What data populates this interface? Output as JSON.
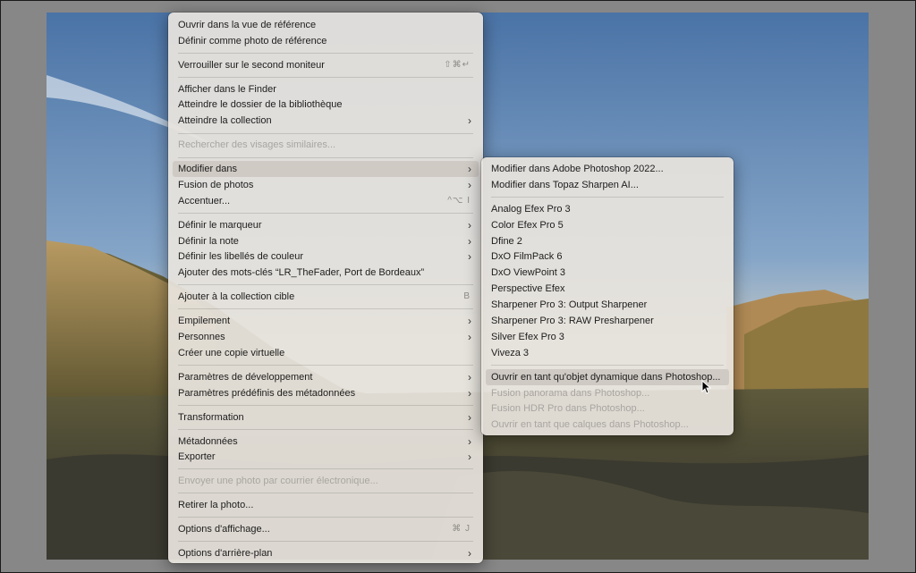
{
  "main_menu": {
    "items": [
      {
        "label": "Ouvrir dans la vue de référence"
      },
      {
        "label": "Définir comme photo de référence"
      },
      {
        "label": "Verrouiller sur le second moniteur",
        "shortcut": "⇧⌘↵"
      },
      {
        "label": "Afficher dans le Finder"
      },
      {
        "label": "Atteindre le dossier de la bibliothèque"
      },
      {
        "label": "Atteindre la collection",
        "submenu": true
      },
      {
        "label": "Rechercher des visages similaires...",
        "disabled": true
      },
      {
        "label": "Modifier dans",
        "submenu": true,
        "highlighted": true
      },
      {
        "label": "Fusion de photos",
        "submenu": true
      },
      {
        "label": "Accentuer...",
        "shortcut": "^⌥ I"
      },
      {
        "label": "Définir le marqueur",
        "submenu": true
      },
      {
        "label": "Définir la note",
        "submenu": true
      },
      {
        "label": "Définir les libellés de couleur",
        "submenu": true
      },
      {
        "label": "Ajouter des mots-clés “LR_TheFader, Port de Bordeaux”"
      },
      {
        "label": "Ajouter à la collection cible",
        "shortcut": "B"
      },
      {
        "label": "Empilement",
        "submenu": true
      },
      {
        "label": "Personnes",
        "submenu": true
      },
      {
        "label": "Créer une copie virtuelle"
      },
      {
        "label": "Paramètres de développement",
        "submenu": true
      },
      {
        "label": "Paramètres prédéfinis des métadonnées",
        "submenu": true
      },
      {
        "label": "Transformation",
        "submenu": true
      },
      {
        "label": "Métadonnées",
        "submenu": true
      },
      {
        "label": "Exporter",
        "submenu": true
      },
      {
        "label": "Envoyer une photo par courrier électronique...",
        "disabled": true
      },
      {
        "label": "Retirer la photo..."
      },
      {
        "label": "Options d'affichage...",
        "shortcut": "⌘ J"
      },
      {
        "label": "Options d'arrière-plan",
        "submenu": true
      }
    ]
  },
  "sub_menu": {
    "items": [
      {
        "label": "Modifier dans Adobe Photoshop 2022..."
      },
      {
        "label": "Modifier dans Topaz Sharpen AI..."
      },
      {
        "label": "Analog Efex Pro 3"
      },
      {
        "label": "Color Efex Pro 5"
      },
      {
        "label": "Dfine 2"
      },
      {
        "label": "DxO FilmPack 6"
      },
      {
        "label": "DxO ViewPoint 3"
      },
      {
        "label": "Perspective Efex"
      },
      {
        "label": "Sharpener Pro 3: Output Sharpener"
      },
      {
        "label": "Sharpener Pro 3: RAW Presharpener"
      },
      {
        "label": "Silver Efex Pro 3"
      },
      {
        "label": "Viveza 3"
      },
      {
        "label": "Ouvrir en tant qu'objet dynamique dans Photoshop...",
        "highlighted": true
      },
      {
        "label": "Fusion panorama dans Photoshop...",
        "disabled": true
      },
      {
        "label": "Fusion HDR Pro dans Photoshop...",
        "disabled": true
      },
      {
        "label": "Ouvrir en tant que calques dans Photoshop...",
        "disabled": true
      }
    ]
  },
  "icons": {
    "submenu_arrow": "chevron-right-icon",
    "cursor": "mouse-pointer-icon"
  },
  "colors": {
    "menu_bg": "#e8e4de",
    "highlight": "#cfcac4",
    "disabled_text": "#a8a5a1"
  }
}
